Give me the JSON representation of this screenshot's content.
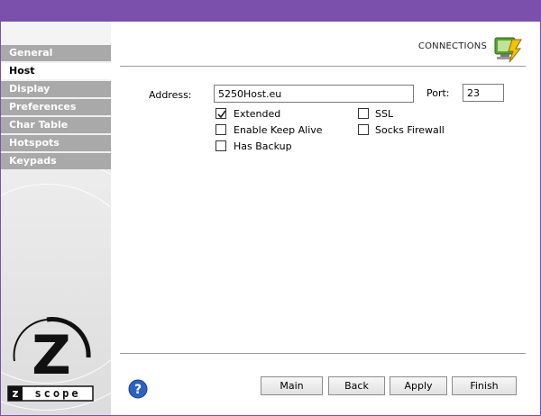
{
  "header": {
    "title": "CONNECTIONS",
    "icon": "connections-icon"
  },
  "nav": {
    "items": [
      {
        "label": "General",
        "active": false
      },
      {
        "label": "Host",
        "active": true
      },
      {
        "label": "Display",
        "active": false
      },
      {
        "label": "Preferences",
        "active": false
      },
      {
        "label": "Char Table",
        "active": false
      },
      {
        "label": "Hotspots",
        "active": false
      },
      {
        "label": "Keypads",
        "active": false
      }
    ]
  },
  "form": {
    "address_label": "Address:",
    "address_value": "5250Host.eu",
    "port_label": "Port:",
    "port_value": "23",
    "checkboxes": {
      "extended": {
        "label": "Extended",
        "checked": true
      },
      "keep_alive": {
        "label": "Enable Keep Alive",
        "checked": false
      },
      "has_backup": {
        "label": "Has Backup",
        "checked": false
      },
      "ssl": {
        "label": "SSL",
        "checked": false
      },
      "socks_firewall": {
        "label": "Socks Firewall",
        "checked": false
      }
    }
  },
  "buttons": {
    "main": "Main",
    "back": "Back",
    "apply": "Apply",
    "finish": "Finish"
  },
  "logo": {
    "text": "scope",
    "letter": "Z"
  },
  "colors": {
    "titlebar": "#7b4fac",
    "nav_inactive": "#a9a9a9",
    "help": "#2a62c4"
  }
}
